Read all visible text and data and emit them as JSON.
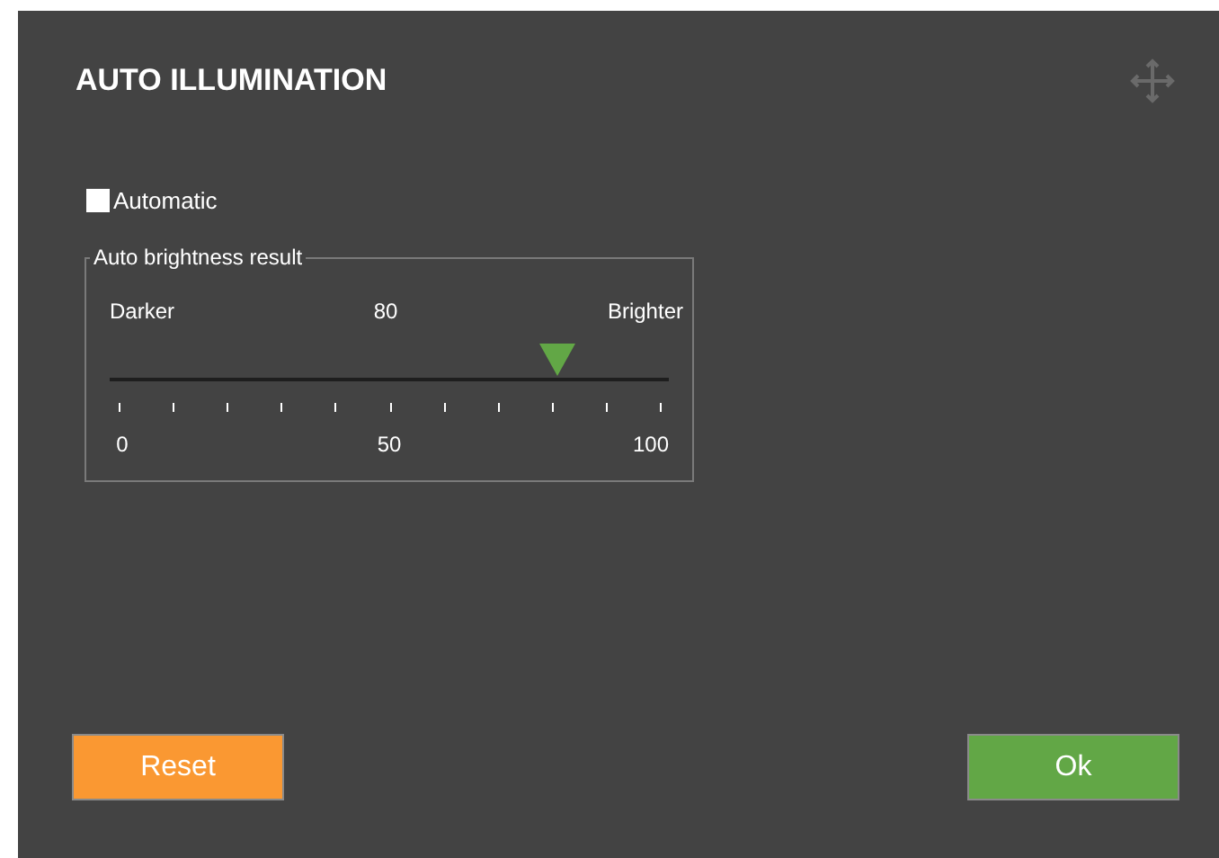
{
  "window": {
    "title": "AUTO ILLUMINATION"
  },
  "automatic": {
    "label": "Automatic",
    "checked": false
  },
  "brightness_group": {
    "title": "Auto brightness result",
    "left_label": "Darker",
    "value": "80",
    "right_label": "Brighter",
    "level": 0.8,
    "scale_labels": [
      "0",
      "50",
      "100"
    ]
  },
  "buttons": [
    {
      "label": "Reset",
      "kind": "reset"
    },
    {
      "label": "Ok",
      "kind": "ok"
    }
  ]
}
